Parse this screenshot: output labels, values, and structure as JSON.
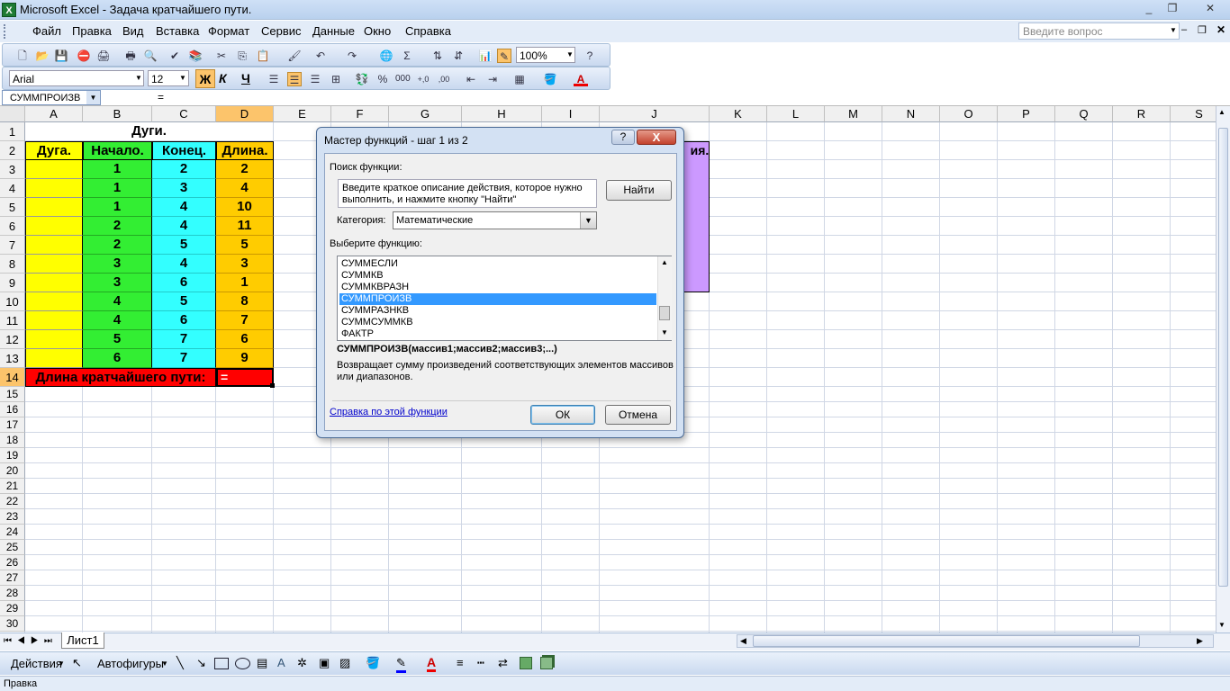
{
  "window": {
    "title": "Microsoft Excel - Задача кратчайшего пути.",
    "app_icon": "excel-icon"
  },
  "window_controls": [
    "_",
    "❐",
    "✕"
  ],
  "menu": [
    "Файл",
    "Правка",
    "Вид",
    "Вставка",
    "Формат",
    "Сервис",
    "Данные",
    "Окно",
    "Справка"
  ],
  "help_search": {
    "placeholder": "Введите вопрос"
  },
  "toolbar_standard": {
    "zoom": "100%"
  },
  "toolbar_format": {
    "font": "Arial",
    "size": "12",
    "bold": "Ж",
    "italic": "К",
    "underline": "Ч"
  },
  "formula_bar": {
    "name_box": "СУММПРОИЗВ",
    "formula": "="
  },
  "columns": [
    "A",
    "B",
    "C",
    "D",
    "E",
    "F",
    "G",
    "H",
    "I",
    "J",
    "K",
    "L",
    "M",
    "N",
    "O",
    "P",
    "Q",
    "R",
    "S"
  ],
  "rows": [
    "1",
    "2",
    "3",
    "4",
    "5",
    "6",
    "7",
    "8",
    "9",
    "10",
    "11",
    "12",
    "13",
    "14",
    "15",
    "16",
    "17",
    "18",
    "19",
    "20",
    "21",
    "22",
    "23",
    "24",
    "25",
    "26",
    "27",
    "28",
    "29",
    "30"
  ],
  "sheet": {
    "title": "Дуги.",
    "headers": [
      "Дуга.",
      "Начало.",
      "Конец.",
      "Длина."
    ],
    "start": [
      "1",
      "1",
      "1",
      "2",
      "2",
      "3",
      "3",
      "4",
      "4",
      "5",
      "6"
    ],
    "end": [
      "2",
      "3",
      "4",
      "4",
      "5",
      "4",
      "6",
      "5",
      "6",
      "7",
      "7"
    ],
    "length": [
      "2",
      "4",
      "10",
      "11",
      "5",
      "3",
      "1",
      "8",
      "7",
      "6",
      "9"
    ],
    "total_label": "Длина кратчайшего пути:",
    "total_value": "=",
    "partial_j2": "ия."
  },
  "colors": {
    "yellow": "#ffff00",
    "green": "#33ee33",
    "cyan": "#33ffff",
    "orange": "#ffcc00",
    "red": "#ff0000",
    "lavender": "#cc99ff"
  },
  "tabs": {
    "sheet1": "Лист1"
  },
  "draw_toolbar": {
    "actions": "Действия",
    "autoshapes": "Автофигуры"
  },
  "status": "Правка",
  "dialog": {
    "title": "Мастер функций - шаг 1 из 2",
    "help_btn": "?",
    "close_btn": "X",
    "search_label": "Поиск функции:",
    "search_text": "Введите краткое описание действия, которое нужно выполнить, и нажмите кнопку \"Найти\"",
    "find_btn": "Найти",
    "category_label": "Категория:",
    "category_value": "Математические",
    "select_label": "Выберите функцию:",
    "functions": [
      "СУММЕСЛИ",
      "СУММКВ",
      "СУММКВРАЗН",
      "СУММПРОИЗВ",
      "СУММРАЗНКВ",
      "СУММСУММКВ",
      "ФАКТР"
    ],
    "selected_function": "СУММПРОИЗВ",
    "signature": "СУММПРОИЗВ(массив1;массив2;массив3;...)",
    "description": "Возвращает сумму произведений соответствующих элементов массивов или диапазонов.",
    "help_link": "Справка по этой функции",
    "ok": "ОК",
    "cancel": "Отмена"
  }
}
